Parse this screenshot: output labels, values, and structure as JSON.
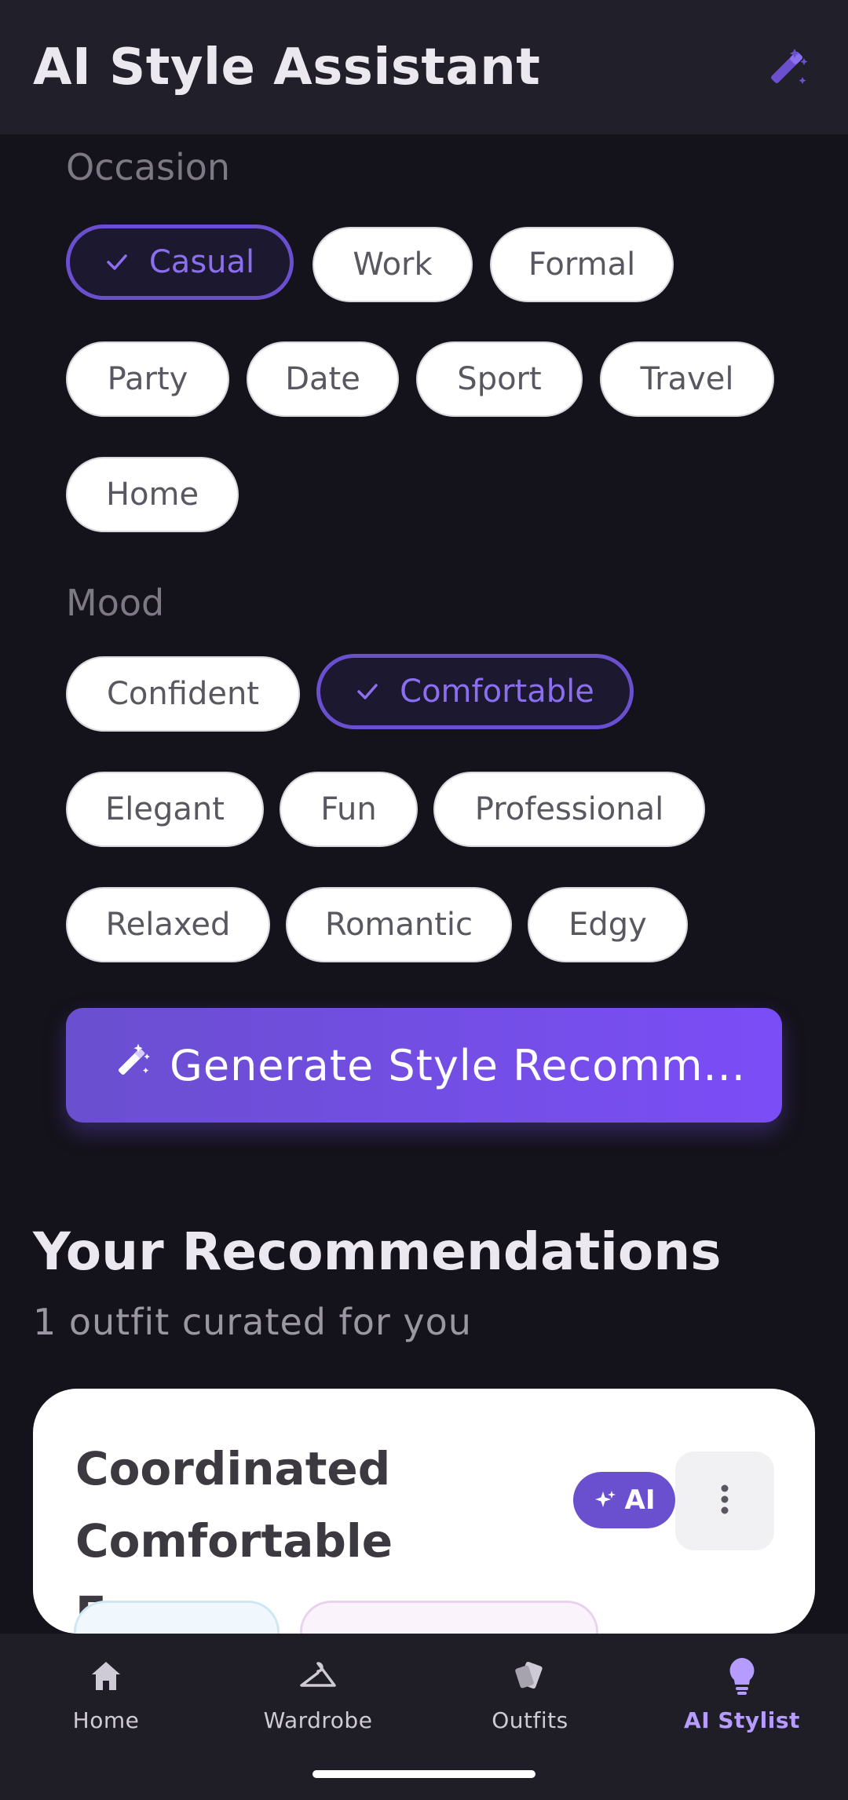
{
  "app": {
    "title": "AI Style Assistant",
    "accent_color": "#6a4fcf",
    "header_icon": "magic-wand-icon"
  },
  "occasion": {
    "label": "Occasion",
    "chips": [
      {
        "label": "Casual",
        "selected": true
      },
      {
        "label": "Work",
        "selected": false
      },
      {
        "label": "Formal",
        "selected": false
      },
      {
        "label": "Party",
        "selected": false
      },
      {
        "label": "Date",
        "selected": false
      },
      {
        "label": "Sport",
        "selected": false
      },
      {
        "label": "Travel",
        "selected": false
      },
      {
        "label": "Home",
        "selected": false
      }
    ]
  },
  "mood": {
    "label": "Mood",
    "chips": [
      {
        "label": "Confident",
        "selected": false
      },
      {
        "label": "Comfortable",
        "selected": true
      },
      {
        "label": "Elegant",
        "selected": false
      },
      {
        "label": "Fun",
        "selected": false
      },
      {
        "label": "Professional",
        "selected": false
      },
      {
        "label": "Relaxed",
        "selected": false
      },
      {
        "label": "Romantic",
        "selected": false
      },
      {
        "label": "Edgy",
        "selected": false
      }
    ]
  },
  "generate_button": {
    "label": "Generate Style Recomm...",
    "icon": "magic-wand-icon"
  },
  "recommendations": {
    "title": "Your Recommendations",
    "subtitle": "1 outfit curated for you",
    "cards": [
      {
        "title_line1": "Coordinated",
        "title_line2": "Comfortable Ense...",
        "badge": "AI",
        "badge_icon": "sparkle-icon",
        "menu_icon": "more-vertical-icon"
      }
    ]
  },
  "bottom_nav": {
    "items": [
      {
        "label": "Home",
        "icon": "home-icon",
        "active": false
      },
      {
        "label": "Wardrobe",
        "icon": "hanger-icon",
        "active": false
      },
      {
        "label": "Outfits",
        "icon": "cards-icon",
        "active": false
      },
      {
        "label": "AI Stylist",
        "icon": "lightbulb-icon",
        "active": true
      }
    ]
  }
}
